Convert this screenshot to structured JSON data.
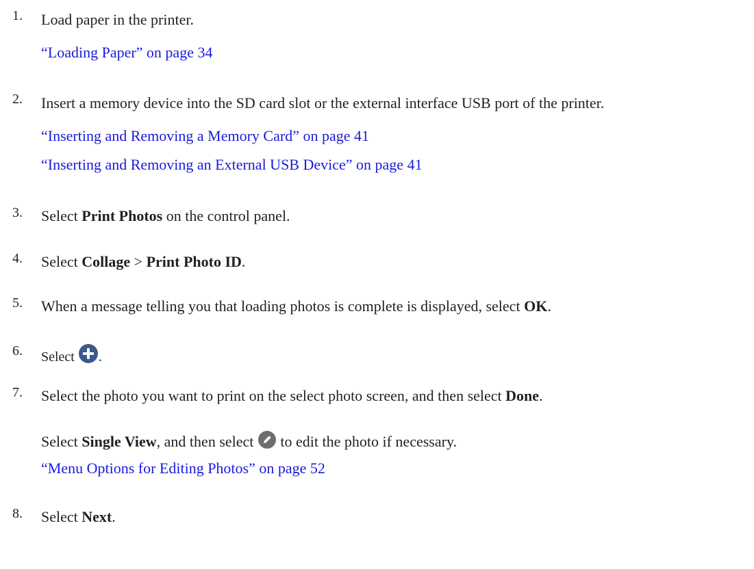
{
  "steps": [
    {
      "number": "1.",
      "text": "Load paper in the printer.",
      "links": [
        "“Loading Paper” on page 34"
      ]
    },
    {
      "number": "2.",
      "text": "Insert a memory device into the SD card slot or the external interface USB port of the printer.",
      "links": [
        "“Inserting and Removing a Memory Card” on page 41",
        "“Inserting and Removing an External USB Device” on page 41"
      ]
    },
    {
      "number": "3.",
      "pre": "Select ",
      "bold": "Print Photos",
      "post": " on the control panel."
    },
    {
      "number": "4.",
      "pre": "Select ",
      "bold1": "Collage",
      "mid": " > ",
      "bold2": "Print Photo ID",
      "post": "."
    },
    {
      "number": "5.",
      "pre": "When a message telling you that loading photos is complete is displayed, select ",
      "bold": "OK",
      "post": "."
    },
    {
      "number": "6.",
      "pre": "Select ",
      "icon": "plus-circle-icon",
      "post": "."
    },
    {
      "number": "7.",
      "pre": "Select the photo you want to print on the select photo screen, and then select ",
      "bold": "Done",
      "post": ".",
      "sub": {
        "pre": "Select ",
        "bold": "Single View",
        "mid": ", and then select ",
        "icon": "pencil-circle-icon",
        "post": " to edit the photo if necessary."
      },
      "links": [
        "“Menu Options for Editing Photos” on page 52"
      ]
    },
    {
      "number": "8.",
      "pre": "Select ",
      "bold": "Next",
      "post": "."
    }
  ],
  "colors": {
    "text": "#231f20",
    "link": "#1a1adb",
    "icon_fill": "#3b5a8c",
    "pencil_icon_fill": "#6e6e6e"
  }
}
